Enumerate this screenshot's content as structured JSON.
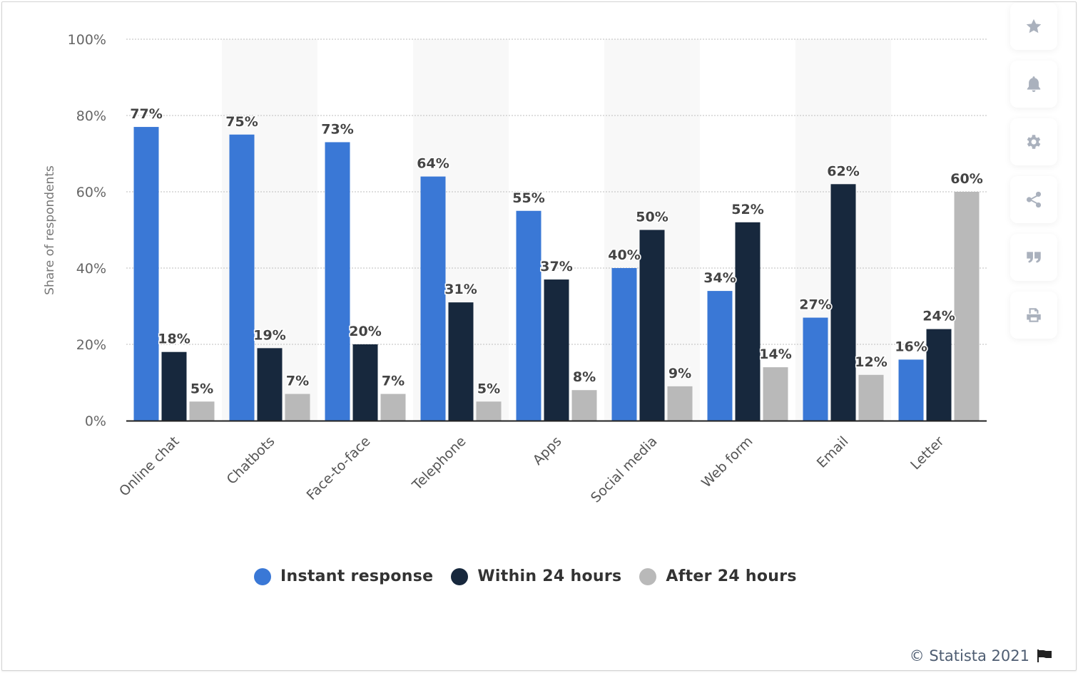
{
  "chart_data": {
    "type": "bar",
    "title": "",
    "xlabel": "",
    "ylabel": "Share of respondents",
    "ylim": [
      0,
      100
    ],
    "yticks": [
      "0%",
      "20%",
      "40%",
      "60%",
      "80%",
      "100%"
    ],
    "ytick_values": [
      0,
      20,
      40,
      60,
      80,
      100
    ],
    "grid": true,
    "legend_position": "bottom",
    "categories": [
      "Online chat",
      "Chatbots",
      "Face-to-face",
      "Telephone",
      "Apps",
      "Social media",
      "Web form",
      "Email",
      "Letter"
    ],
    "series": [
      {
        "name": "Instant response",
        "color": "#3a78d6",
        "values": [
          77,
          75,
          73,
          64,
          55,
          40,
          34,
          27,
          16
        ]
      },
      {
        "name": "Within 24 hours",
        "color": "#17283d",
        "values": [
          18,
          19,
          20,
          31,
          37,
          50,
          52,
          62,
          24
        ]
      },
      {
        "name": "After 24 hours",
        "color": "#b9b9b9",
        "values": [
          5,
          7,
          7,
          5,
          8,
          9,
          14,
          12,
          60
        ]
      }
    ],
    "value_suffix": "%"
  },
  "legend": {
    "items": [
      {
        "label": "Instant response",
        "color": "#3a78d6"
      },
      {
        "label": "Within 24 hours",
        "color": "#17283d"
      },
      {
        "label": "After 24 hours",
        "color": "#b9b9b9"
      }
    ]
  },
  "sidebar": {
    "buttons": [
      {
        "icon": "star-icon",
        "label": "Favorite"
      },
      {
        "icon": "bell-icon",
        "label": "Notifications"
      },
      {
        "icon": "gear-icon",
        "label": "Settings"
      },
      {
        "icon": "share-icon",
        "label": "Share"
      },
      {
        "icon": "quote-icon",
        "label": "Cite"
      },
      {
        "icon": "print-icon",
        "label": "Print"
      }
    ]
  },
  "footer": {
    "copyright": "© Statista 2021"
  }
}
